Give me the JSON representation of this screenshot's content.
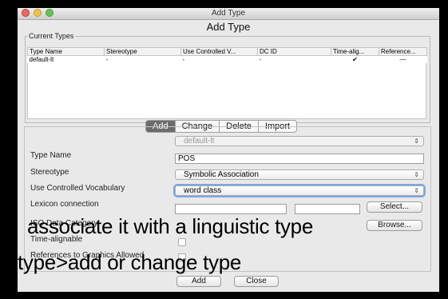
{
  "window": {
    "title": "Add Type",
    "dialog_title": "Add Type"
  },
  "current_types": {
    "legend": "Current Types",
    "columns": [
      "Type Name",
      "Stereotype",
      "Use Controlled V...",
      "DC ID",
      "Time-alig...",
      "Reference..."
    ],
    "rows": [
      [
        "default-lt",
        "-",
        "-",
        "-",
        "✔",
        "—"
      ]
    ]
  },
  "tabs": [
    "Add",
    "Change",
    "Delete",
    "Import"
  ],
  "selected_tab": "Add",
  "form": {
    "type_select_value": "default-lt",
    "type_name_label": "Type Name",
    "type_name_value": "POS",
    "stereotype_label": "Stereotype",
    "stereotype_value": "Symbolic Association",
    "ucv_label": "Use Controlled Vocabulary",
    "ucv_value": "word class",
    "lexicon_label": "Lexicon connection",
    "select_button": "Select...",
    "isocat_label": "ISO Data Category",
    "browse_button": "Browse...",
    "time_alignable_label": "Time-alignable",
    "refs_label": "References to Graphics Allowed",
    "add_button": "Add",
    "close_button": "Close"
  },
  "overlay": {
    "line1": "associate it with a linguistic type",
    "line2": "type>add or change type"
  },
  "icons": {
    "combo_arrow": "updown-arrow-icon"
  }
}
